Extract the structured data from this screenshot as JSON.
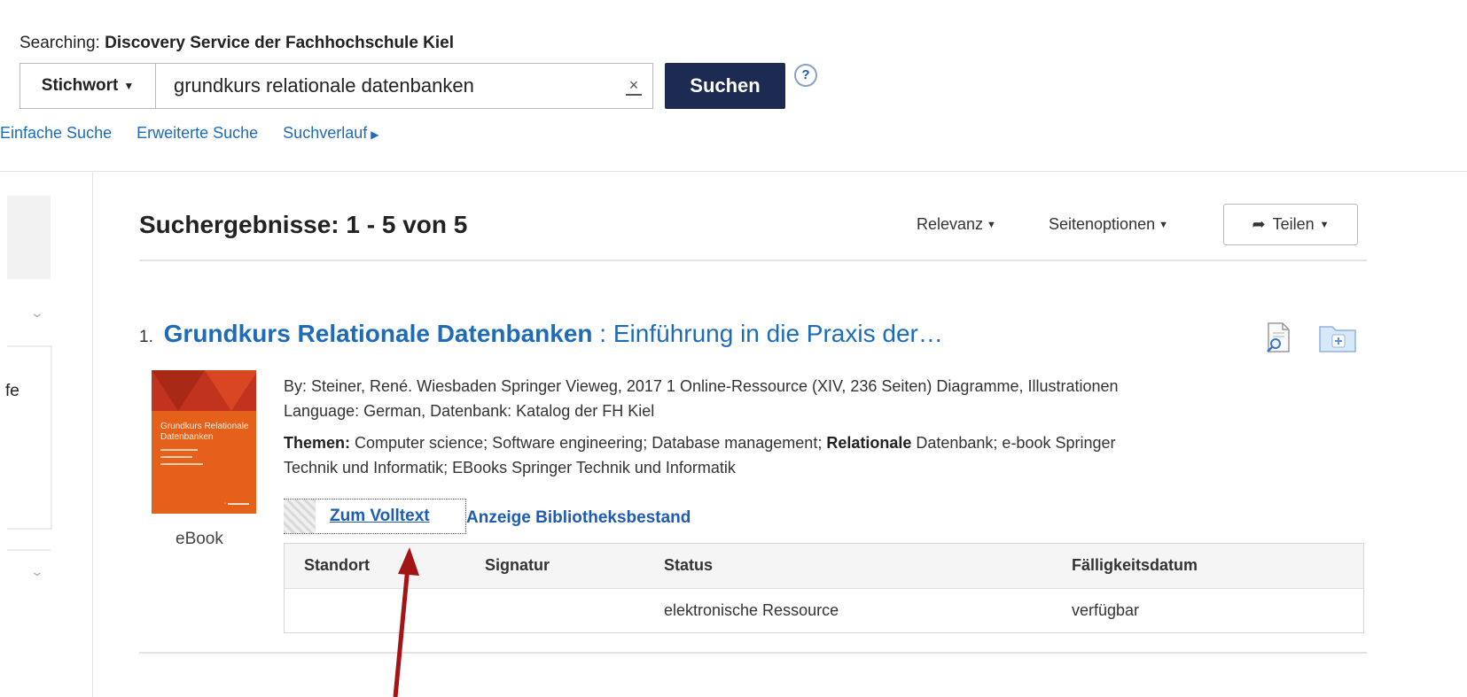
{
  "header": {
    "searching_label": "Searching:",
    "database": "Discovery Service der Fachhochschule Kiel"
  },
  "search": {
    "field": "Stichwort",
    "query": "grundkurs relationale datenbanken",
    "clear": "×",
    "submit": "Suchen",
    "help": "?"
  },
  "nav_links": [
    "Einfache Suche",
    "Erweiterte Suche",
    "Suchverlauf"
  ],
  "left_sidebar": {
    "partial_text": "fe"
  },
  "results": {
    "heading": "Suchergebnisse: 1 - 5 von 5",
    "sort_label": "Relevanz",
    "page_options_label": "Seitenoptionen",
    "share_label": "Teilen"
  },
  "record": {
    "number": "1.",
    "title_bold": "Grundkurs Relationale Datenbanken",
    "title_rest": " : Einführung in die Praxis der…",
    "byline": "By: Steiner, René. Wiesbaden Springer Vieweg, 2017 1 Online-Ressource (XIV, 236 Seiten) Diagramme, Illustrationen",
    "language_line": "Language: German, Datenbank: Katalog der FH Kiel",
    "themen_label": "Themen:",
    "themen_part1": " Computer science; Software engineering; Database management; ",
    "themen_bold": "Relationale",
    "themen_part2": " Datenbank; e-book Springer",
    "themen_line2": "Technik und Informatik; EBooks Springer Technik und Informatik",
    "format": "eBook",
    "cover_title": "Grundkurs Relationale Datenbanken",
    "fulltext_link": "Zum Volltext",
    "holdings_link": "Anzeige Bibliotheksbestand"
  },
  "holdings_table": {
    "headers": [
      "Standort",
      "Signatur",
      "Status",
      "Fälligkeitsdatum"
    ],
    "rows": [
      [
        "",
        "",
        "elektronische Ressource",
        "verfügbar"
      ]
    ]
  },
  "annotation": {
    "arrow_color": "#a31515"
  }
}
